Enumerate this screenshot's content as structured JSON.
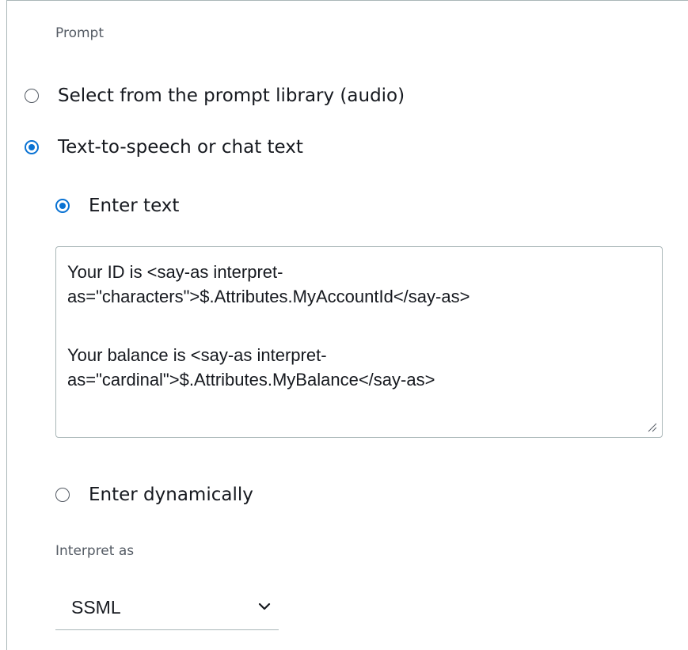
{
  "prompt_section": {
    "label": "Prompt",
    "options": [
      {
        "label": "Select from the prompt library (audio)",
        "selected": false
      },
      {
        "label": "Text-to-speech or chat text",
        "selected": true
      }
    ]
  },
  "text_source": {
    "options": [
      {
        "label": "Enter text",
        "selected": true
      },
      {
        "label": "Enter dynamically",
        "selected": false
      }
    ]
  },
  "text_input": {
    "lines": [
      "Your ID is <say-as interpret-",
      "as=\"characters\">$.Attributes.MyAccountId</say-as>",
      "",
      "Your balance is <say-as interpret-",
      "as=\"cardinal\">$.Attributes.MyBalance</say-as>"
    ]
  },
  "interpret_as": {
    "label": "Interpret as",
    "value": "SSML"
  },
  "colors": {
    "accent": "#0972d3",
    "border": "#aab7b8",
    "text": "#16191f",
    "muted": "#545b64"
  }
}
